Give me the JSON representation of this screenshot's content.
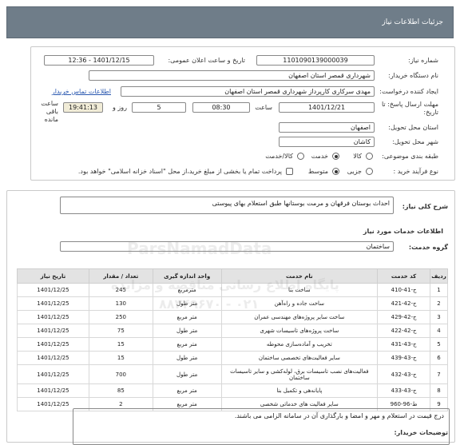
{
  "header": {
    "title": "جزئیات اطلاعات نیاز"
  },
  "form": {
    "need_number_label": "شماره نیاز:",
    "need_number": "1101090139000039",
    "announce_label": "تاریخ و ساعت اعلان عمومی:",
    "announce_value": "1401/12/15 - 12:36",
    "buyer_org_label": "نام دستگاه خریدار:",
    "buyer_org": "شهرداری قمصر استان اصفهان",
    "requester_label": "ایجاد کننده درخواست:",
    "requester": "مهدی سرکاری کارپرداز شهرداری قمصر استان اصفهان",
    "contact_link": "اطلاعات تماس خریدار",
    "deadline_label": "مهلت ارسال پاسخ: تا تاریخ:",
    "deadline_date": "1401/12/21",
    "time_label": "ساعت",
    "deadline_time": "08:30",
    "days_value": "5",
    "days_label": "روز و",
    "remaining_time": "19:41:13",
    "remaining_label": "ساعت باقی مانده",
    "province_label": "استان محل تحویل:",
    "province": "اصفهان",
    "city_label": "شهر محل تحویل:",
    "city": "کاشان",
    "category_label": "طبقه بندی موضوعی:",
    "category_options": [
      "کالا",
      "خدمت",
      "کالا/خدمت"
    ],
    "process_label": "نوع فرآیند خرید :",
    "process_options": [
      "جزیی",
      "متوسط"
    ],
    "payment_note": "پرداخت تمام یا بخشی از مبلغ خرید،از محل \"اسناد خزانه اسلامی\" خواهد بود."
  },
  "details": {
    "general_desc_label": "شرح کلی نیاز:",
    "general_desc": "احداث بوستان فرقهان و مرمت بوستانها طبق استعلام بهای پیوستی",
    "services_header": "اطلاعات خدمات مورد نیاز",
    "group_label": "گروه خدمت:",
    "group_value": "ساختمان",
    "columns": [
      "ردیف",
      "کد خدمت",
      "نام خدمت",
      "واحد اندازه گیری",
      "تعداد / مقدار",
      "تاریخ نیاز"
    ],
    "rows": [
      [
        "1",
        "ج-41-410",
        "ساخت بنا",
        "مترمربع",
        "245",
        "1401/12/25"
      ],
      [
        "2",
        "ج-42-421",
        "ساخت جاده و راه‌آهن",
        "متر طول",
        "130",
        "1401/12/25"
      ],
      [
        "3",
        "ج-42-429",
        "ساخت سایر پروژه‌های مهندسی عمران",
        "متر مربع",
        "250",
        "1401/12/25"
      ],
      [
        "4",
        "ج-42-422",
        "ساخت پروژه‌های تاسیسات شهری",
        "متر طول",
        "75",
        "1401/12/25"
      ],
      [
        "5",
        "ج-43-431",
        "تخریب و آماده‌سازی محوطه",
        "متر مربع",
        "15",
        "1401/12/25"
      ],
      [
        "6",
        "ج-43-439",
        "سایر فعالیت‌های تخصصی ساختمان",
        "متر طول",
        "15",
        "1401/12/25"
      ],
      [
        "7",
        "ج-43-432",
        "فعالیت‌های نصب تاسیسات برق، لوله‌کشی و سایر تاسیسات ساختمان",
        "متر طول",
        "700",
        "1401/12/25"
      ],
      [
        "8",
        "ج-43-433",
        "پایانه‌هی و تکمیل بنا",
        "متر مربع",
        "85",
        "1401/12/25"
      ],
      [
        "9",
        "ط-96-960",
        "سایر فعالیت های خدماتی شخصی",
        "متر مربع",
        "2",
        "1401/12/25"
      ]
    ],
    "buyer_notes_label": "توضیحات خریدار:",
    "buyer_notes": "درج قیمت در استعلام و مهر و امضا و بارگذاری آن در سامانه الزامی می باشند."
  },
  "watermark": {
    "site": "ParsNamadData",
    "line1": "پایگاه اطلاع رسانی مناقصه و مزایده",
    "line2": "۰۲۱ - ۸۸۳۴۹۶۷۰"
  }
}
